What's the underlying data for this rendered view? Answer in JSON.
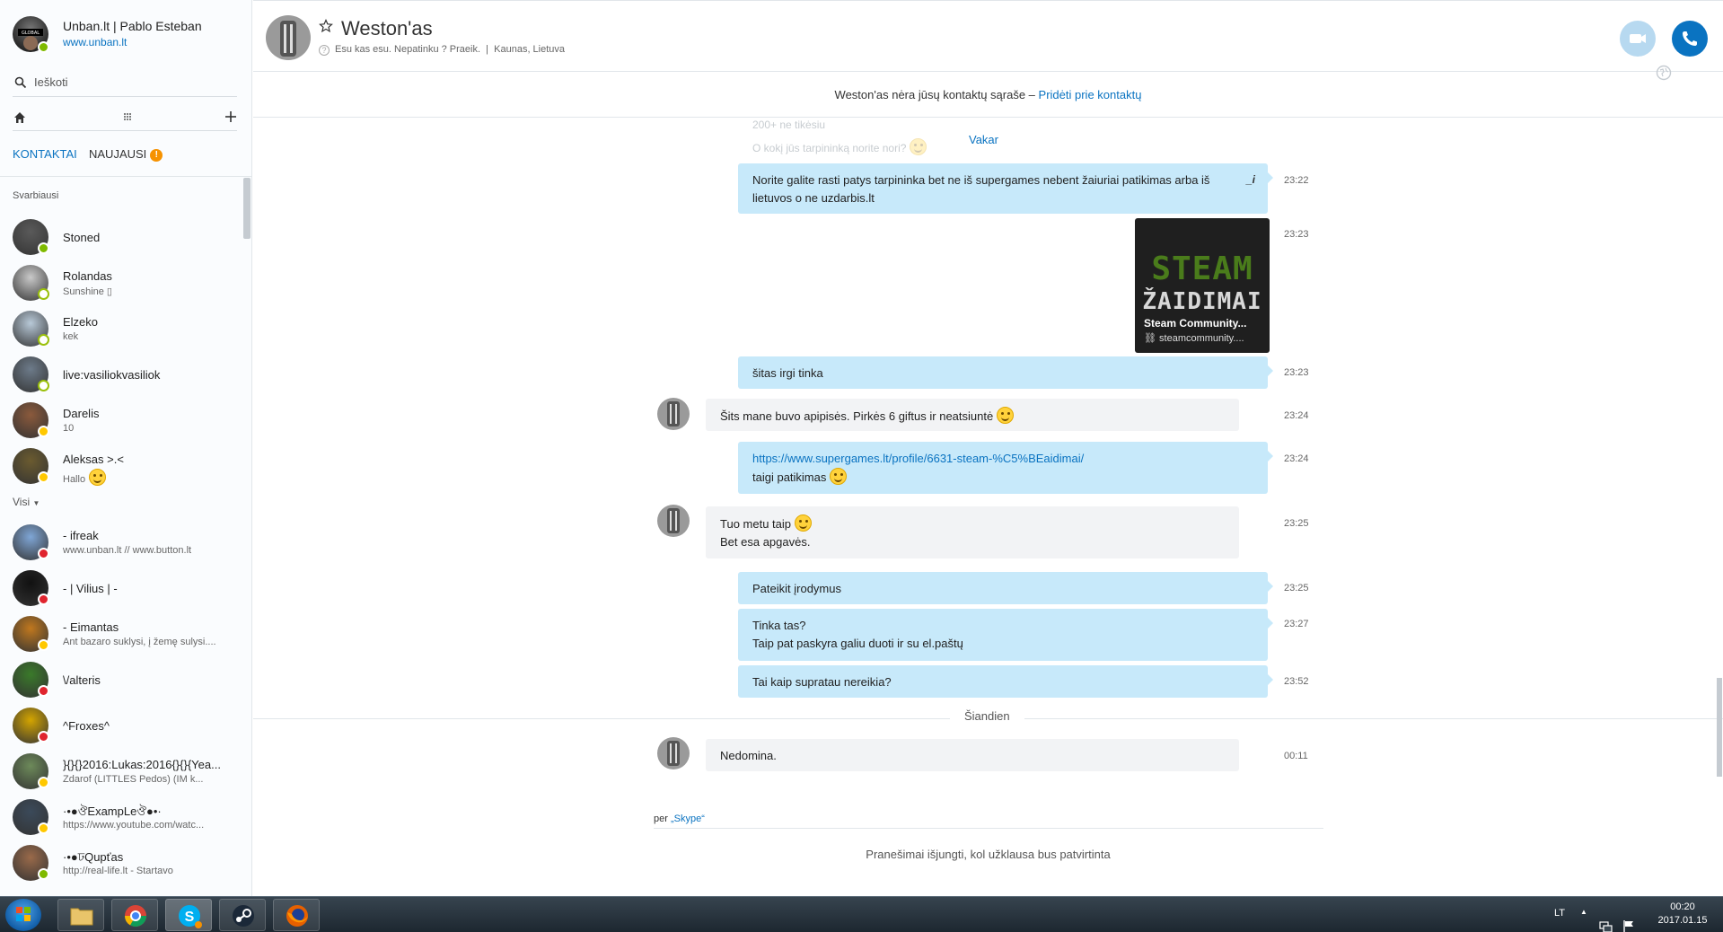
{
  "profile": {
    "name": "Unban.lt | Pablo Esteban",
    "link": "www.unban.lt"
  },
  "search": {
    "placeholder": "Ieškoti"
  },
  "tabs": {
    "contacts": "KONTAKTAI",
    "recent": "NAUJAUSI",
    "recent_badge": "!"
  },
  "sections": {
    "favorites": "Svarbiausi",
    "all": "Visi"
  },
  "favorites": [
    {
      "name": "Stoned",
      "mood": "",
      "status": "online"
    },
    {
      "name": "Rolandas",
      "mood": "Sunshine ▯",
      "status": "offline"
    },
    {
      "name": "Elzeko",
      "mood": "kek",
      "status": "offline"
    },
    {
      "name": "live:vasiliokvasiliok",
      "mood": "",
      "status": "offline"
    },
    {
      "name": "Darelis",
      "mood": "10",
      "status": "away"
    },
    {
      "name": "Aleksas >.<",
      "mood": "Hallo",
      "status": "away"
    }
  ],
  "all_contacts": [
    {
      "name": "-                   ifreak",
      "mood": "www.unban.lt // www.button.lt",
      "status": "dnd"
    },
    {
      "name": "- | Vilius | -",
      "mood": "",
      "status": "dnd"
    },
    {
      "name": "- Eimantas",
      "mood": "Ant bazaro suklysi, į žemę sulysi....",
      "status": "away"
    },
    {
      "name": "\\/alteris",
      "mood": "",
      "status": "dnd"
    },
    {
      "name": "^Froxes^",
      "mood": "",
      "status": "dnd"
    },
    {
      "name": "}{}{}2016:Lukas:2016{}{}{Yea...",
      "mood": "Zdarof  (LITTLES Pedos) (IM k...",
      "status": "away"
    },
    {
      "name": "·•●ঔExampLeঔ●•·",
      "mood": "https://www.youtube.com/watc...",
      "status": "away"
    },
    {
      "name": "·•●ঢQupťas",
      "mood": "http://real-life.lt - Startavo",
      "status": "online"
    }
  ],
  "chat": {
    "title": "Weston'as",
    "subtitle": "Esu kas esu. Nepatinku ? Praeik.",
    "location": "Kaunas, Lietuva",
    "notice_text": "Weston'as nėra jūsų kontaktų sąraše – ",
    "notice_link": "Pridėti prie kontaktų",
    "faded_1": "200+ ne tikėsiu",
    "faded_2": "O kokį jūs tarpininką norite nori?",
    "day_yesterday": "Vakar",
    "day_today": "Šiandien",
    "via_prefix": "per ",
    "via_app": "„Skype“",
    "pending": "Pranešimai išjungti, kol užklausa bus patvirtinta"
  },
  "messages": {
    "m1": {
      "line1": "Norite galite rasti patys tarpininka bet ne iš supergames nebent žaiuriai patikimas arba iš",
      "line2": "lietuvos o ne uzdarbis.lt",
      "time": "23:22"
    },
    "m2": {
      "title": "Steam Community...",
      "link": "steamcommunity....",
      "word1": "STEAM",
      "word2": "ŽAIDIMAI",
      "time": "23:23"
    },
    "m3": {
      "text": "šitas irgi tinka",
      "time": "23:23"
    },
    "m4": {
      "text": "Šits mane buvo apipisės. Pirkės 6 giftus ir neatsiuntė",
      "time": "23:24"
    },
    "m5": {
      "link": "https://www.supergames.lt/profile/6631-steam-%C5%BEaidimai/",
      "line2": "taigi patikimas",
      "time": "23:24"
    },
    "m6": {
      "line1": "Tuo metu taip",
      "line2": "Bet esa apgavės.",
      "time": "23:25"
    },
    "m7": {
      "text": "Pateikit įrodymus",
      "time": "23:25"
    },
    "m8": {
      "line1": "Tinka tas?",
      "line2": "Taip pat paskyra galiu duoti ir su el.paštų",
      "time": "23:27"
    },
    "m9": {
      "text": "Tai kaip supratau nereikia?",
      "time": "23:52"
    },
    "m10": {
      "text": "Nedomina.",
      "time": "00:11"
    }
  },
  "taskbar": {
    "language": "LT",
    "time": "00:20",
    "date": "2017.01.15"
  }
}
